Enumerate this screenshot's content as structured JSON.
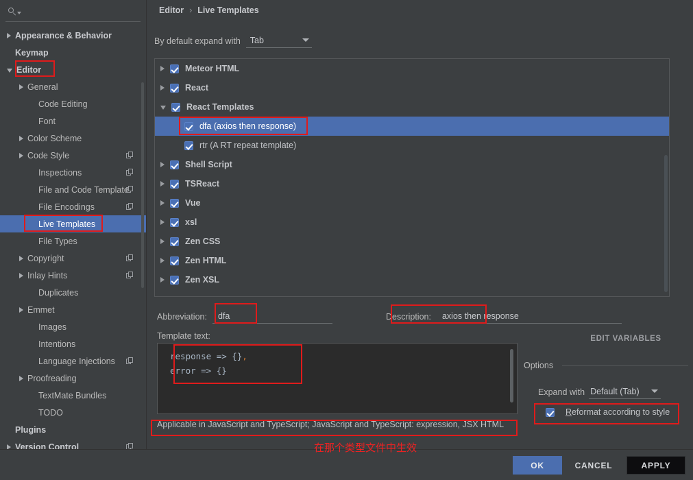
{
  "window": {
    "accent_blue": "#4b6eaf",
    "bg": "#3c3f41",
    "annotation_red": "#e01b1b"
  },
  "search": {
    "placeholder": "",
    "value": "",
    "icon": "search-icon"
  },
  "sidebar": {
    "items": [
      {
        "label": "Appearance & Behavior",
        "indent": 0,
        "arrow": "right",
        "bold": true,
        "copy": false,
        "selected": false
      },
      {
        "label": "Keymap",
        "indent": 0,
        "arrow": "none",
        "bold": true,
        "copy": false,
        "selected": false
      },
      {
        "label": "Editor",
        "indent": 0,
        "arrow": "down",
        "bold": true,
        "copy": false,
        "selected": false
      },
      {
        "label": "General",
        "indent": 1,
        "arrow": "right",
        "bold": false,
        "copy": false,
        "selected": false
      },
      {
        "label": "Code Editing",
        "indent": 2,
        "arrow": "none",
        "bold": false,
        "copy": false,
        "selected": false
      },
      {
        "label": "Font",
        "indent": 2,
        "arrow": "none",
        "bold": false,
        "copy": false,
        "selected": false
      },
      {
        "label": "Color Scheme",
        "indent": 1,
        "arrow": "right",
        "bold": false,
        "copy": false,
        "selected": false
      },
      {
        "label": "Code Style",
        "indent": 1,
        "arrow": "right",
        "bold": false,
        "copy": true,
        "selected": false
      },
      {
        "label": "Inspections",
        "indent": 2,
        "arrow": "none",
        "bold": false,
        "copy": true,
        "selected": false
      },
      {
        "label": "File and Code Template",
        "indent": 2,
        "arrow": "none",
        "bold": false,
        "copy": true,
        "selected": false
      },
      {
        "label": "File Encodings",
        "indent": 2,
        "arrow": "none",
        "bold": false,
        "copy": true,
        "selected": false
      },
      {
        "label": "Live Templates",
        "indent": 2,
        "arrow": "none",
        "bold": false,
        "copy": false,
        "selected": true
      },
      {
        "label": "File Types",
        "indent": 2,
        "arrow": "none",
        "bold": false,
        "copy": false,
        "selected": false
      },
      {
        "label": "Copyright",
        "indent": 1,
        "arrow": "right",
        "bold": false,
        "copy": true,
        "selected": false
      },
      {
        "label": "Inlay Hints",
        "indent": 1,
        "arrow": "right",
        "bold": false,
        "copy": true,
        "selected": false
      },
      {
        "label": "Duplicates",
        "indent": 2,
        "arrow": "none",
        "bold": false,
        "copy": false,
        "selected": false
      },
      {
        "label": "Emmet",
        "indent": 1,
        "arrow": "right",
        "bold": false,
        "copy": false,
        "selected": false
      },
      {
        "label": "Images",
        "indent": 2,
        "arrow": "none",
        "bold": false,
        "copy": false,
        "selected": false
      },
      {
        "label": "Intentions",
        "indent": 2,
        "arrow": "none",
        "bold": false,
        "copy": false,
        "selected": false
      },
      {
        "label": "Language Injections",
        "indent": 2,
        "arrow": "none",
        "bold": false,
        "copy": true,
        "selected": false
      },
      {
        "label": "Proofreading",
        "indent": 1,
        "arrow": "right",
        "bold": false,
        "copy": false,
        "selected": false
      },
      {
        "label": "TextMate Bundles",
        "indent": 2,
        "arrow": "none",
        "bold": false,
        "copy": false,
        "selected": false
      },
      {
        "label": "TODO",
        "indent": 2,
        "arrow": "none",
        "bold": false,
        "copy": false,
        "selected": false
      },
      {
        "label": "Plugins",
        "indent": 0,
        "arrow": "none",
        "bold": true,
        "copy": false,
        "selected": false
      },
      {
        "label": "Version Control",
        "indent": 0,
        "arrow": "right",
        "bold": true,
        "copy": true,
        "selected": false
      }
    ],
    "help_label": "?"
  },
  "breadcrumb": {
    "root": "Editor",
    "separator": "›",
    "leaf": "Live Templates"
  },
  "expand_default": {
    "label": "By default expand with",
    "value": "Tab"
  },
  "templates_list": [
    {
      "label": "Meteor HTML",
      "checked": true,
      "arrow": "right",
      "child": false,
      "selected": false
    },
    {
      "label": "React",
      "checked": true,
      "arrow": "right",
      "child": false,
      "selected": false
    },
    {
      "label": "React Templates",
      "checked": true,
      "arrow": "down",
      "child": false,
      "selected": false
    },
    {
      "label": "dfa (axios then response)",
      "checked": true,
      "arrow": "none",
      "child": true,
      "selected": true
    },
    {
      "label": "rtr (A RT repeat template)",
      "checked": true,
      "arrow": "none",
      "child": true,
      "selected": false
    },
    {
      "label": "Shell Script",
      "checked": true,
      "arrow": "right",
      "child": false,
      "selected": false
    },
    {
      "label": "TSReact",
      "checked": true,
      "arrow": "right",
      "child": false,
      "selected": false
    },
    {
      "label": "Vue",
      "checked": true,
      "arrow": "right",
      "child": false,
      "selected": false
    },
    {
      "label": "xsl",
      "checked": true,
      "arrow": "right",
      "child": false,
      "selected": false
    },
    {
      "label": "Zen CSS",
      "checked": true,
      "arrow": "right",
      "child": false,
      "selected": false
    },
    {
      "label": "Zen HTML",
      "checked": true,
      "arrow": "right",
      "child": false,
      "selected": false
    },
    {
      "label": "Zen XSL",
      "checked": true,
      "arrow": "right",
      "child": false,
      "selected": false
    }
  ],
  "list_toolbar": [
    {
      "name": "add-button",
      "icon": "plus-icon"
    },
    {
      "name": "remove-button",
      "icon": "minus-icon"
    },
    {
      "name": "duplicate-button",
      "icon": "copy-icon"
    },
    {
      "name": "revert-button",
      "icon": "undo-icon"
    }
  ],
  "fields": {
    "abbreviation_label": "Abbreviation:",
    "abbreviation_value": "dfa",
    "description_label": "Description:",
    "description_value": "axios then response",
    "template_text_label": "Template text:",
    "template_code_line1": "response => {}",
    "template_code_comma": ",",
    "template_code_line2": "error => {}"
  },
  "applicable": "Applicable in JavaScript and TypeScript; JavaScript and TypeScript: expression, JSX HTML",
  "options": {
    "edit_variables": "EDIT VARIABLES",
    "title": "Options",
    "expand_with_label": "Expand with",
    "expand_with_value": "Default (Tab)",
    "reformat_label_head": "R",
    "reformat_label_rest": "eformat according to style",
    "reformat_checked": true
  },
  "buttons": {
    "ok": "OK",
    "cancel": "CANCEL",
    "apply": "APPLY"
  },
  "annotation": {
    "chinese_note": "在那个类型文件中生效"
  }
}
